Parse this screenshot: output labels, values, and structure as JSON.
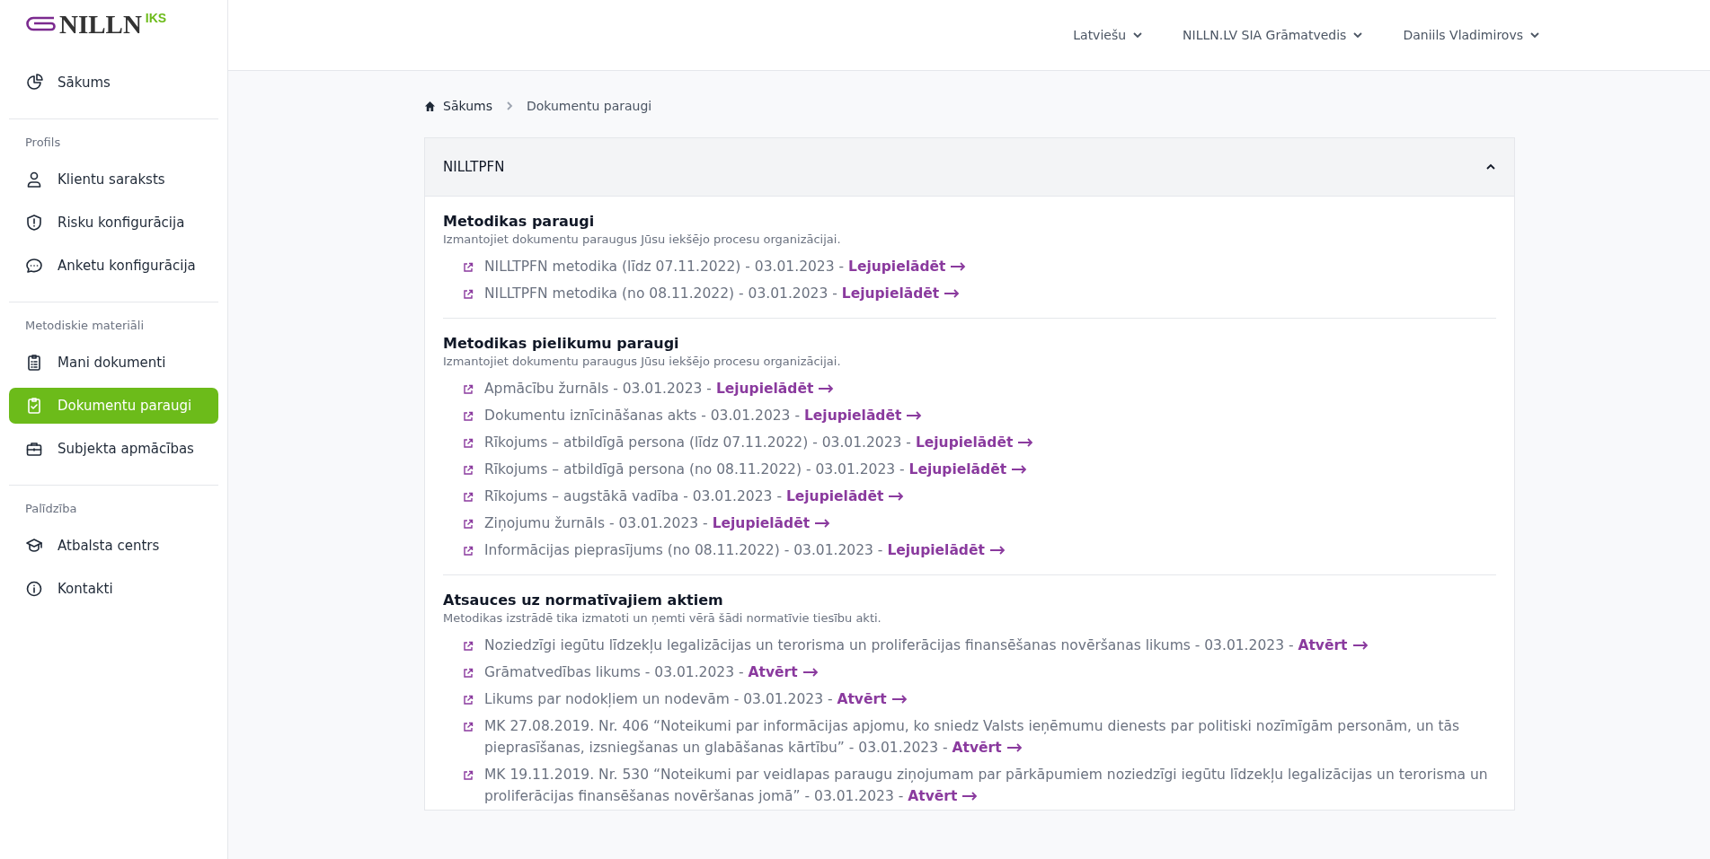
{
  "logo": {
    "name": "NILLN",
    "suffix": "IKS"
  },
  "topbar": {
    "menus": [
      {
        "label": "Latviešu"
      },
      {
        "label": "NILLN.LV SIA Grāmatvedis"
      },
      {
        "label": "Daniils Vladimirovs"
      }
    ]
  },
  "sidebar": {
    "groups": [
      {
        "items": [
          {
            "label": "Sākums",
            "selected": false
          }
        ]
      },
      {
        "title": "Profils",
        "items": [
          {
            "label": "Klientu saraksts",
            "selected": false
          },
          {
            "label": "Risku konfigurācija",
            "selected": false
          },
          {
            "label": "Anketu konfigurācija",
            "selected": false
          }
        ]
      },
      {
        "title": "Metodiskie materiāli",
        "items": [
          {
            "label": "Mani dokumenti",
            "selected": false
          },
          {
            "label": "Dokumentu paraugi",
            "selected": true
          },
          {
            "label": "Subjekta apmācības",
            "selected": false
          }
        ]
      },
      {
        "title": "Palīdzība",
        "items": [
          {
            "label": "Atbalsta centrs",
            "selected": false
          },
          {
            "label": "Kontakti",
            "selected": false
          }
        ]
      }
    ]
  },
  "breadcrumb": [
    {
      "label": "Sākums"
    },
    {
      "label": "Dokumentu paraugi"
    }
  ],
  "panel": {
    "title": "NILLTPFN",
    "expanded": true,
    "sections": [
      {
        "title": "Metodikas paraugi",
        "subtitle": "Izmantojiet dokumentu paraugus Jūsu iekšējo procesu organizācijai.",
        "items": [
          {
            "text": "NILLTPFN metodika (līdz 07.11.2022) - 03.01.2023 -",
            "link": "Lejupielādēt"
          },
          {
            "text": "NILLTPFN metodika (no 08.11.2022) - 03.01.2023 -",
            "link": "Lejupielādēt"
          }
        ]
      },
      {
        "title": "Metodikas pielikumu paraugi",
        "subtitle": "Izmantojiet dokumentu paraugus Jūsu iekšējo procesu organizācijai.",
        "items": [
          {
            "text": "Apmācību žurnāls - 03.01.2023 -",
            "link": "Lejupielādēt"
          },
          {
            "text": "Dokumentu iznīcināšanas akts - 03.01.2023 -",
            "link": "Lejupielādēt"
          },
          {
            "text": "Rīkojums – atbildīgā persona (līdz 07.11.2022) - 03.01.2023 -",
            "link": "Lejupielādēt"
          },
          {
            "text": "Rīkojums – atbildīgā persona (no 08.11.2022) - 03.01.2023 -",
            "link": "Lejupielādēt"
          },
          {
            "text": "Rīkojums – augstākā vadība - 03.01.2023 -",
            "link": "Lejupielādēt"
          },
          {
            "text": "Ziņojumu žurnāls - 03.01.2023 -",
            "link": "Lejupielādēt"
          },
          {
            "text": "Informācijas pieprasījums (no 08.11.2022) - 03.01.2023 -",
            "link": "Lejupielādēt"
          }
        ]
      },
      {
        "title": "Atsauces uz normatīvajiem aktiem",
        "subtitle": "Metodikas izstrādē tika izmatoti un ņemti vērā šādi normatīvie tiesību akti.",
        "items": [
          {
            "text": "Noziedzīgi iegūtu līdzekļu legalizācijas un terorisma un proliferācijas finansēšanas novēršanas likums - 03.01.2023 -",
            "link": "Atvērt"
          },
          {
            "text": "Grāmatvedības likums - 03.01.2023 -",
            "link": "Atvērt"
          },
          {
            "text": "Likums par nodokļiem un nodevām - 03.01.2023 -",
            "link": "Atvērt"
          },
          {
            "text": "MK 27.08.2019. Nr. 406 “Noteikumi par informācijas apjomu, ko sniedz Valsts ieņēmumu dienests par politiski nozīmīgām personām, un tās pieprasīšanas, izsniegšanas un glabāšanas kārtību” - 03.01.2023 -",
            "link": "Atvērt"
          },
          {
            "text": "MK 19.11.2019. Nr. 530 “Noteikumi par veidlapas paraugu ziņojumam par pārkāpumiem noziedzīgi iegūtu līdzekļu legalizācijas un terorisma un proliferācijas finansēšanas novēršanas jomā” - 03.01.2023 -",
            "link": "Atvērt"
          }
        ]
      }
    ]
  }
}
